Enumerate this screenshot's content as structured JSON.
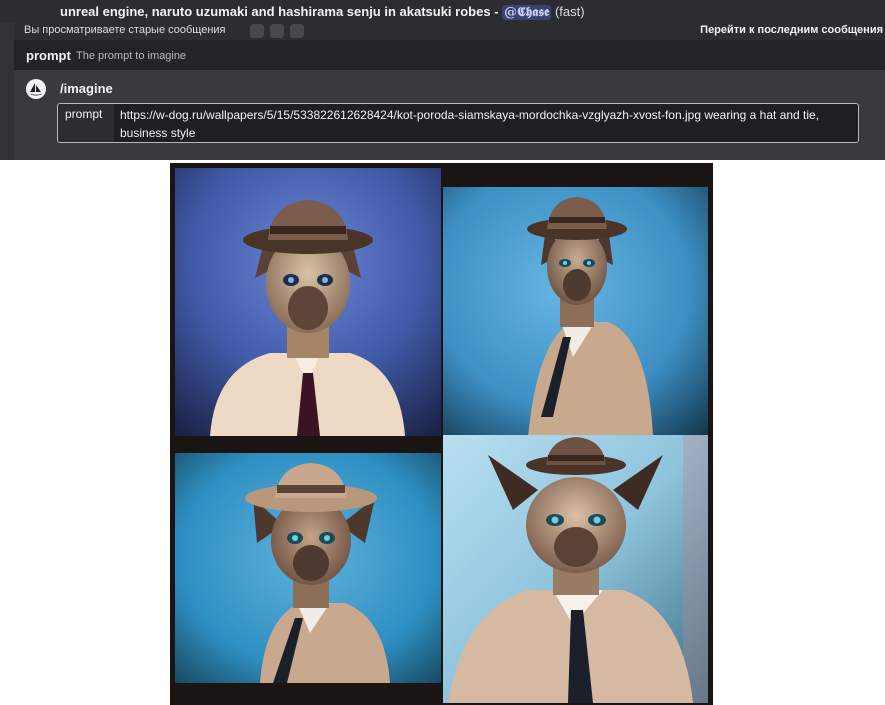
{
  "message": {
    "text": "unreal engine, naruto uzumaki and hashirama senju in akatsuki robes - ",
    "mention": "@𝕮𝖍𝖆𝖘𝖊",
    "mode": "(fast)"
  },
  "banner": {
    "left_text": "Вы просматриваете старые сообщения",
    "right_text": "Перейти к последним сообщения"
  },
  "option_hint": {
    "name": "prompt",
    "description": "The prompt to imagine"
  },
  "command": {
    "name": "/imagine",
    "bot_icon": "midjourney-sailboat-icon",
    "option_label": "prompt",
    "option_value": "https://w-dog.ru/wallpapers/5/15/533822612628424/kot-poroda-siamskaya-mordochka-vzglyazh-xvost-fon.jpg wearing a hat and tie, business style"
  },
  "colors": {
    "panel_bg": "#313338",
    "input_bg": "#1e1f22",
    "mention_bg": "#3c4270",
    "tile1_bg": "#3f5aa6",
    "tile2_bg": "#3d8fc4",
    "tile3_bg": "#2e8fc2",
    "tile4_bg": "#8fc4dd"
  },
  "images": [
    {
      "subject": "siamese cat in fedora, white shirt and dark tie"
    },
    {
      "subject": "siamese cat in fedora, beige jacket and dark tie"
    },
    {
      "subject": "siamese cat in fedora, beige jacket and dark tie"
    },
    {
      "subject": "siamese cat in fedora, beige jacket and dark tie"
    }
  ]
}
